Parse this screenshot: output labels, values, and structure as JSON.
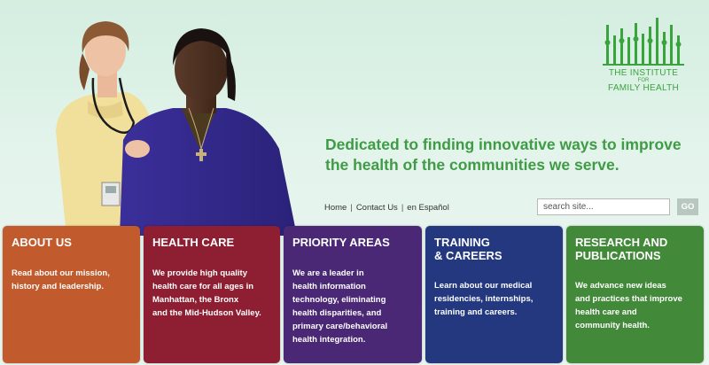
{
  "header": {
    "logo": {
      "line1": "THE INSTITUTE",
      "line2": "FOR",
      "line3": "FAMILY HEALTH"
    },
    "tagline_line1": "Dedicated to finding innovative ways to improve",
    "tagline_line2": "the health of the communities we serve.",
    "hero_photo": "hero-photo-doctor-and-patient"
  },
  "utility_nav": {
    "items": [
      {
        "label": "Home"
      },
      {
        "label": "Contact Us"
      },
      {
        "label": "en Español"
      }
    ],
    "separator": "|"
  },
  "search": {
    "placeholder": "search site...",
    "button_label": "GO"
  },
  "tiles": [
    {
      "title": "ABOUT US",
      "text": "Read about our mission,\nhistory and leadership.",
      "color": "#c15a2c"
    },
    {
      "title": "HEALTH CARE",
      "text": "We provide high quality\nhealth care for all ages in\nManhattan, the Bronx\nand the Mid-Hudson Valley.",
      "color": "#8e1f32"
    },
    {
      "title": "PRIORITY AREAS",
      "text": "We are a leader in\nhealth information\ntechnology, eliminating\nhealth disparities, and\nprimary care/behavioral\nhealth integration.",
      "color": "#4a2876"
    },
    {
      "title": "TRAINING\n& CAREERS",
      "text": "Learn about our medical\nresidencies, internships,\ntraining and careers.",
      "color": "#23387f"
    },
    {
      "title": "RESEARCH AND\nPUBLICATIONS",
      "text": "We advance new ideas\nand practices that improve\nhealth care and\ncommunity health.",
      "color": "#43893a"
    }
  ],
  "colors": {
    "brand_green": "#3f9b45",
    "background": "#e2f3ea"
  }
}
